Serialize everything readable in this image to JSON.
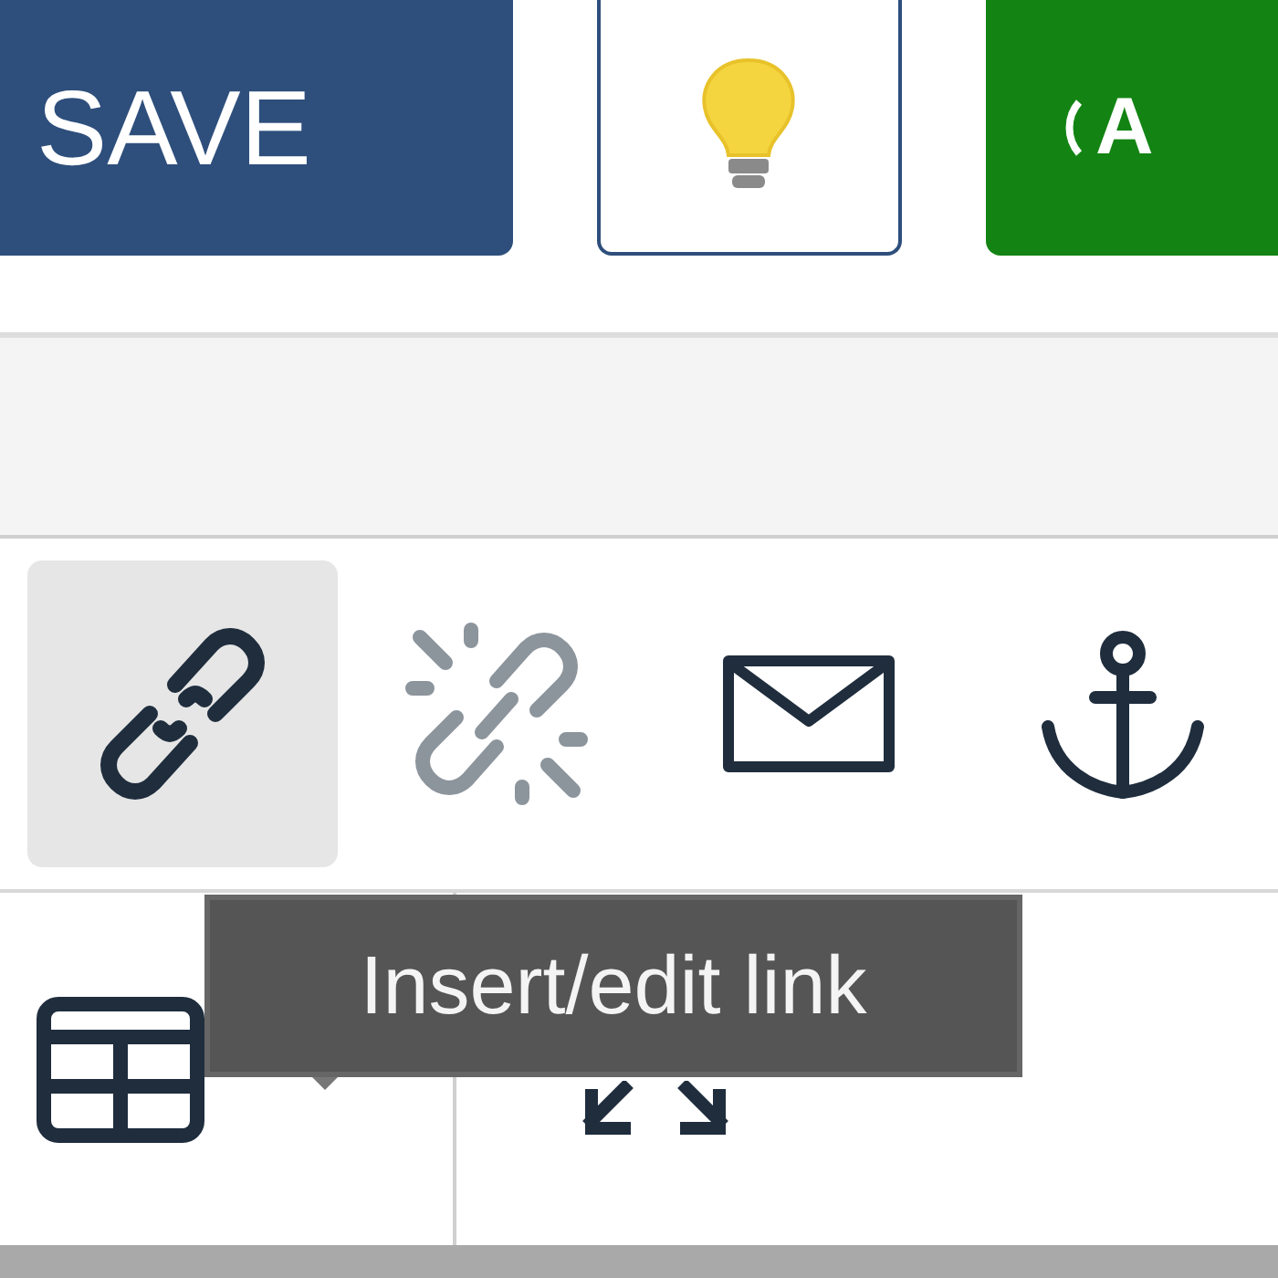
{
  "top_buttons": [
    {
      "kind": "text",
      "label": "SAVE"
    },
    {
      "kind": "bulb"
    },
    {
      "kind": "speech",
      "label": "A"
    }
  ],
  "toolbar": [
    {
      "kind": "link",
      "selected": true,
      "disabled": false
    },
    {
      "kind": "unlink",
      "selected": false,
      "disabled": true
    },
    {
      "kind": "email",
      "selected": false,
      "disabled": false
    },
    {
      "kind": "anchor",
      "selected": false,
      "disabled": false
    }
  ],
  "toolbar2": [
    {
      "kind": "table"
    },
    {
      "kind": "fullscreen"
    }
  ],
  "tooltip": {
    "text": "Insert/edit link"
  }
}
